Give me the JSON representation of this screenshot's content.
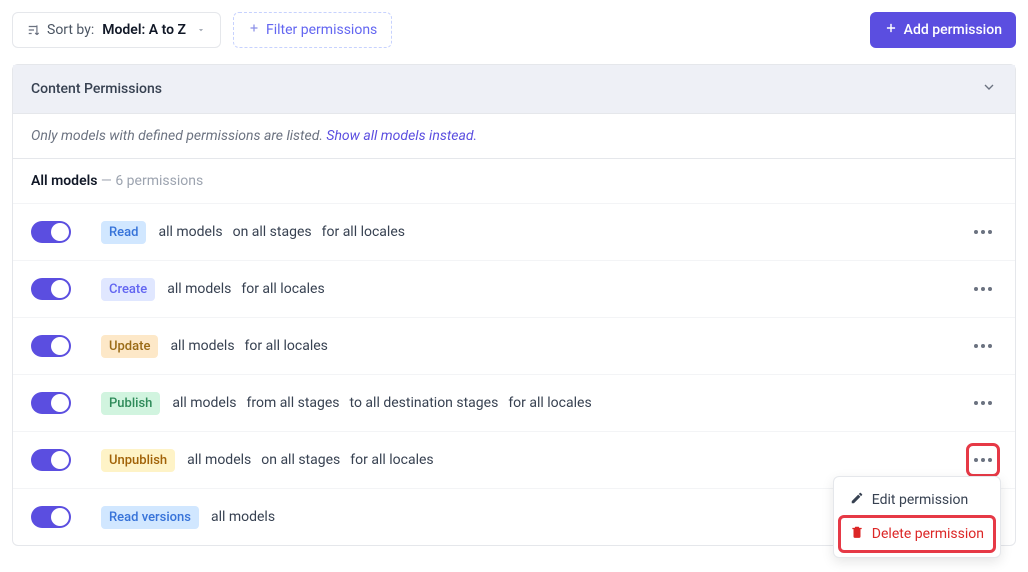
{
  "toolbar": {
    "sort_label": "Sort by:",
    "sort_value": "Model: A to Z",
    "filter_label": "Filter permissions",
    "add_label": "Add permission"
  },
  "panel": {
    "title": "Content Permissions",
    "notice_text": "Only models with defined permissions are listed.",
    "notice_link": "Show all models instead.",
    "group_title": "All models",
    "group_count": "— 6 permissions"
  },
  "rows": [
    {
      "badge": "Read",
      "badgeClass": "badge-read",
      "scopes": [
        "all models",
        "on all stages",
        "for all locales"
      ],
      "menuOpen": false,
      "highlightDots": false
    },
    {
      "badge": "Create",
      "badgeClass": "badge-create",
      "scopes": [
        "all models",
        "for all locales"
      ],
      "menuOpen": false,
      "highlightDots": false
    },
    {
      "badge": "Update",
      "badgeClass": "badge-update",
      "scopes": [
        "all models",
        "for all locales"
      ],
      "menuOpen": false,
      "highlightDots": false
    },
    {
      "badge": "Publish",
      "badgeClass": "badge-publish",
      "scopes": [
        "all models",
        "from all stages",
        "to all destination stages",
        "for all locales"
      ],
      "menuOpen": false,
      "highlightDots": false
    },
    {
      "badge": "Unpublish",
      "badgeClass": "badge-unpublish",
      "scopes": [
        "all models",
        "on all stages",
        "for all locales"
      ],
      "menuOpen": true,
      "highlightDots": true
    },
    {
      "badge": "Read versions",
      "badgeClass": "badge-readv",
      "scopes": [
        "all models"
      ],
      "menuOpen": false,
      "highlightDots": false
    }
  ],
  "menu": {
    "edit": "Edit permission",
    "delete": "Delete permission"
  }
}
